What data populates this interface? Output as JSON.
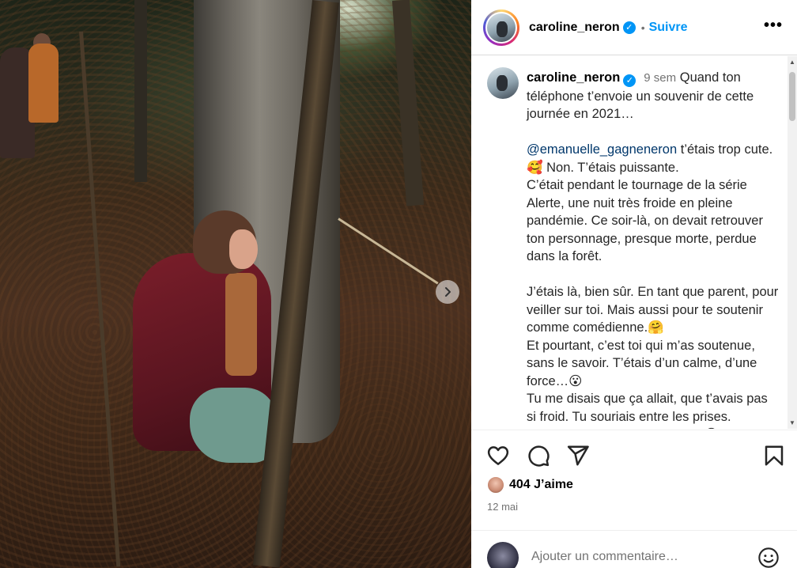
{
  "header": {
    "username": "caroline_neron",
    "follow_label": "Suivre",
    "separator": "•",
    "more_label": "•••"
  },
  "caption": {
    "username": "caroline_neron",
    "time_ago": "9 sem",
    "text_intro": " Quand ton téléphone t’envoie un souvenir de cette journée en 2021…\n\n",
    "mention": "@emanuelle_gagneneron",
    "text_body": " t’étais trop cute. 🥰 Non. T’étais puissante.\nC’était pendant le tournage de la série Alerte, une nuit très froide en pleine pandémie. Ce soir-là, on devait retrouver ton personnage, presque morte, perdue dans la forêt.\n\nJ’étais là, bien sûr. En tant que parent, pour veiller sur toi. Mais aussi pour te soutenir comme comédienne.🤗\nEt pourtant, c’est toi qui m’as soutenue, sans le savoir. T’étais d’un calme, d’une force…😮\nTu me disais que ça allait, que t’avais pas si froid. Tu souriais entre les prises.\nTu étais tellement à ton image.😍"
  },
  "post": {
    "likes": "404 J’aime",
    "date": "12 mai"
  },
  "comment": {
    "placeholder": "Ajouter un commentaire…"
  },
  "icons": {
    "like": "heart-icon",
    "comment": "comment-icon",
    "share": "share-icon",
    "save": "bookmark-icon",
    "emoji": "emoji-icon",
    "verified": "verified-badge-icon",
    "next": "chevron-right-icon"
  },
  "colors": {
    "accent": "#0095f6",
    "mention": "#00376b",
    "muted": "#737373"
  }
}
